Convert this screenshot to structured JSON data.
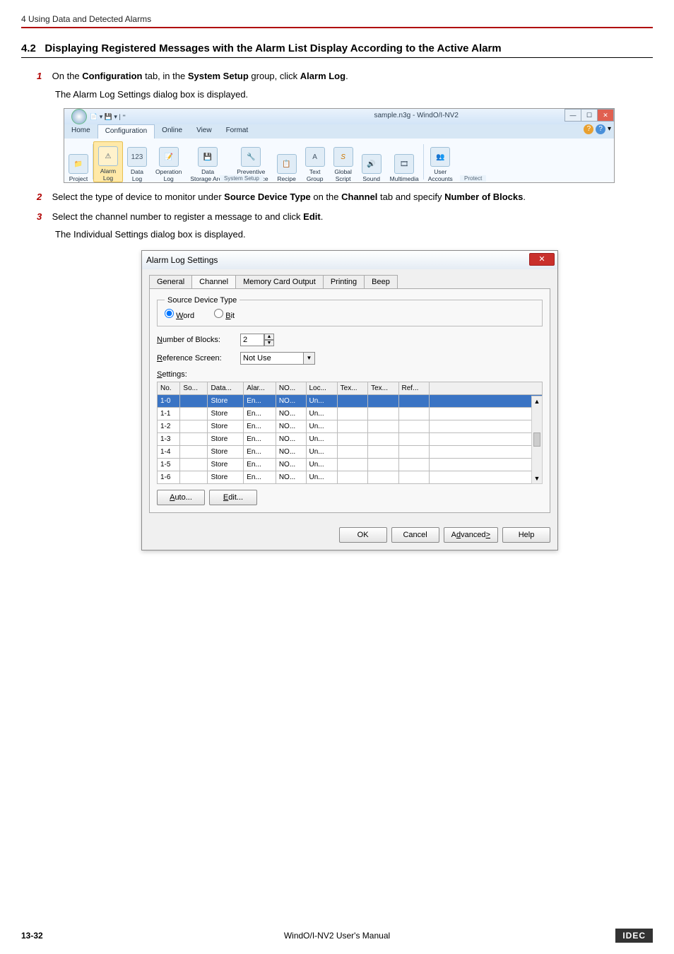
{
  "header": {
    "chapter": "4 Using Data and Detected Alarms"
  },
  "section": {
    "number": "4.2",
    "title": "Displaying Registered Messages with the Alarm List Display According to the Active Alarm"
  },
  "steps": {
    "s1": {
      "num": "1",
      "pre": "On the ",
      "b1": "Configuration",
      "mid1": " tab, in the ",
      "b2": "System Setup",
      "mid2": " group, click ",
      "b3": "Alarm Log",
      "post": ".",
      "desc": "The Alarm Log Settings dialog box is displayed."
    },
    "s2": {
      "num": "2",
      "pre": "Select the type of device to monitor under ",
      "b1": "Source Device Type",
      "mid1": " on the ",
      "b2": "Channel",
      "mid2": " tab and specify ",
      "b3": "Number of Blocks",
      "post": "."
    },
    "s3": {
      "num": "3",
      "pre": "Select the channel number to register a message to and click ",
      "b1": "Edit",
      "post": ".",
      "desc": "The Individual Settings dialog box is displayed."
    }
  },
  "ribbon": {
    "window_title": "sample.n3g - WindO/I-NV2",
    "tabs": {
      "home": "Home",
      "configuration": "Configuration",
      "online": "Online",
      "view": "View",
      "format": "Format"
    },
    "items": {
      "project": "Project",
      "alarm_log": "Alarm\nLog",
      "data_log": "Data\nLog",
      "operation_log": "Operation\nLog",
      "data_storage_area": "Data\nStorage Area",
      "preventive_maintenance": "Preventive\nMaintenance",
      "recipe": "Recipe",
      "text_group": "Text\nGroup",
      "global_script": "Global\nScript",
      "sound": "Sound",
      "multimedia": "Multimedia",
      "user_accounts": "User\nAccounts"
    },
    "group_label_system_setup": "System Setup",
    "group_label_protect": "Protect",
    "icons": {
      "i123": "123"
    }
  },
  "dialog": {
    "title": "Alarm Log Settings",
    "tabs": {
      "general": "General",
      "channel": "Channel",
      "memory": "Memory Card Output",
      "printing": "Printing",
      "beep": "Beep"
    },
    "group_source_device_type": "Source Device Type",
    "radio_word": "Word",
    "radio_bit": "Bit",
    "label_num_blocks": "Number of Blocks:",
    "value_num_blocks": "2",
    "label_ref_screen": "Reference Screen:",
    "value_ref_screen": "Not Use",
    "label_settings": "Settings:",
    "headers": {
      "no": "No.",
      "so": "So...",
      "data": "Data...",
      "alar": "Alar...",
      "no2": "NO...",
      "loc": "Loc...",
      "tex1": "Tex...",
      "tex2": "Tex...",
      "ref": "Ref..."
    },
    "rows": [
      {
        "no": "1-0",
        "so": "",
        "data": "Store",
        "alar": "En...",
        "no2": "NO...",
        "loc": "Un..."
      },
      {
        "no": "1-1",
        "so": "",
        "data": "Store",
        "alar": "En...",
        "no2": "NO...",
        "loc": "Un..."
      },
      {
        "no": "1-2",
        "so": "",
        "data": "Store",
        "alar": "En...",
        "no2": "NO...",
        "loc": "Un..."
      },
      {
        "no": "1-3",
        "so": "",
        "data": "Store",
        "alar": "En...",
        "no2": "NO...",
        "loc": "Un..."
      },
      {
        "no": "1-4",
        "so": "",
        "data": "Store",
        "alar": "En...",
        "no2": "NO...",
        "loc": "Un..."
      },
      {
        "no": "1-5",
        "so": "",
        "data": "Store",
        "alar": "En...",
        "no2": "NO...",
        "loc": "Un..."
      },
      {
        "no": "1-6",
        "so": "",
        "data": "Store",
        "alar": "En...",
        "no2": "NO...",
        "loc": "Un..."
      }
    ],
    "buttons": {
      "auto": "Auto...",
      "edit": "Edit...",
      "ok": "OK",
      "cancel": "Cancel",
      "advanced": "Advanced ≥",
      "help": "Help"
    }
  },
  "footer": {
    "page_number": "13-32",
    "center": "WindO/I-NV2 User's Manual",
    "logo": "IDEC"
  }
}
